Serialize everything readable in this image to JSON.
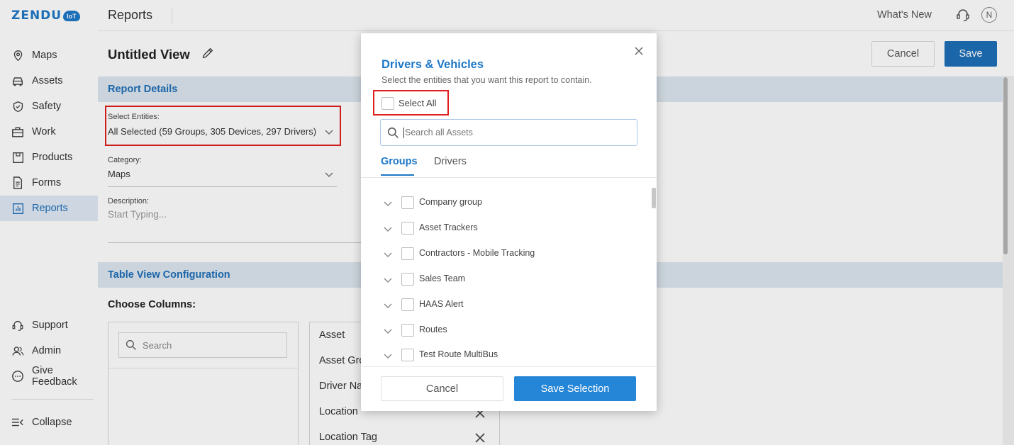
{
  "brand": {
    "name": "ZENDU",
    "suffix": "IoT"
  },
  "sidebar": {
    "items": [
      {
        "label": "Maps",
        "icon": "map-pin-icon"
      },
      {
        "label": "Assets",
        "icon": "car-icon"
      },
      {
        "label": "Safety",
        "icon": "shield-icon"
      },
      {
        "label": "Work",
        "icon": "briefcase-icon"
      },
      {
        "label": "Products",
        "icon": "product-icon"
      },
      {
        "label": "Forms",
        "icon": "document-icon"
      },
      {
        "label": "Reports",
        "icon": "chart-icon",
        "active": true
      }
    ],
    "bottom": [
      {
        "label": "Support",
        "icon": "headset-icon"
      },
      {
        "label": "Admin",
        "icon": "users-icon"
      },
      {
        "label": "Give Feedback",
        "icon": "chat-icon"
      }
    ],
    "collapse": "Collapse"
  },
  "topbar": {
    "title": "Reports",
    "whats_new": "What's New",
    "avatar": "N"
  },
  "view": {
    "title": "Untitled View",
    "cancel": "Cancel",
    "save": "Save",
    "report_details": {
      "title": "Report Details",
      "select_entities_label": "Select Entities:",
      "select_entities_value": "All Selected (59 Groups, 305 Devices, 297 Drivers)",
      "category_label": "Category:",
      "category_value": "Maps",
      "description_label": "Description:",
      "description_placeholder": "Start Typing..."
    },
    "table_config": {
      "title": "Table View Configuration",
      "choose_columns": "Choose Columns:",
      "search_placeholder": "Search",
      "selected_columns": [
        "Asset",
        "Asset Gro",
        "Driver Na",
        "Location",
        "Location Tag"
      ]
    }
  },
  "modal": {
    "title": "Drivers & Vehicles",
    "subtitle": "Select the entities that you want this report to contain.",
    "select_all": "Select All",
    "search_placeholder": "Search all Assets",
    "tabs": [
      "Groups",
      "Drivers"
    ],
    "groups": [
      "Company group",
      "Asset Trackers",
      "Contractors - Mobile Tracking",
      "Sales Team",
      "HAAS Alert",
      "Routes",
      "Test Route MultiBus"
    ],
    "cancel": "Cancel",
    "save_selection": "Save Selection"
  },
  "colors": {
    "accent": "#1e6fb8",
    "highlight": "#e02020",
    "section_band": "#dde6ef"
  }
}
